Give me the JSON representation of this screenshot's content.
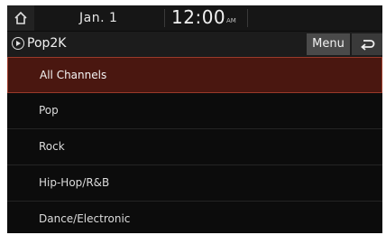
{
  "status": {
    "date": "Jan.  1",
    "time": "12:00",
    "ampm": "AM"
  },
  "titlebar": {
    "channel": "Pop2K",
    "menu_label": "Menu"
  },
  "list": {
    "items": [
      {
        "label": "All Channels"
      },
      {
        "label": "Pop"
      },
      {
        "label": "Rock"
      },
      {
        "label": "Hip-Hop/R&B"
      },
      {
        "label": "Dance/Electronic"
      }
    ]
  },
  "colors": {
    "selected_bg": "#4a1710",
    "selected_border": "#9a3a2a"
  },
  "icons": [
    "home-icon",
    "play-circle-icon",
    "back-arrow-icon"
  ]
}
